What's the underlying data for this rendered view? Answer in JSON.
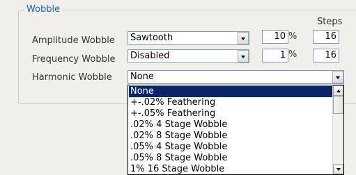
{
  "group": {
    "title": "Wobble"
  },
  "steps_header": "Steps",
  "rows": [
    {
      "label": "Amplitude Wobble",
      "selected": "Sawtooth",
      "amount": "10",
      "unit": "%",
      "steps": "16"
    },
    {
      "label": "Frequency Wobble",
      "selected": "Disabled",
      "amount": "1",
      "unit": "%",
      "steps": "16"
    },
    {
      "label": "Harmonic Wobble",
      "selected": "None"
    }
  ],
  "dropdown": {
    "options": [
      "None",
      "+-.02% Feathering",
      "+-.05% Feathering",
      ".02% 4 Stage Wobble",
      ".02% 8 Stage Wobble",
      ".05% 4 Stage Wobble",
      ".05% 8 Stage Wobble",
      "1% 16 Stage Wobble"
    ],
    "highlighted": "None"
  },
  "colors": {
    "group_title": "#1f5ec9",
    "highlight": "#0a246a",
    "background": "#f0efe9"
  }
}
